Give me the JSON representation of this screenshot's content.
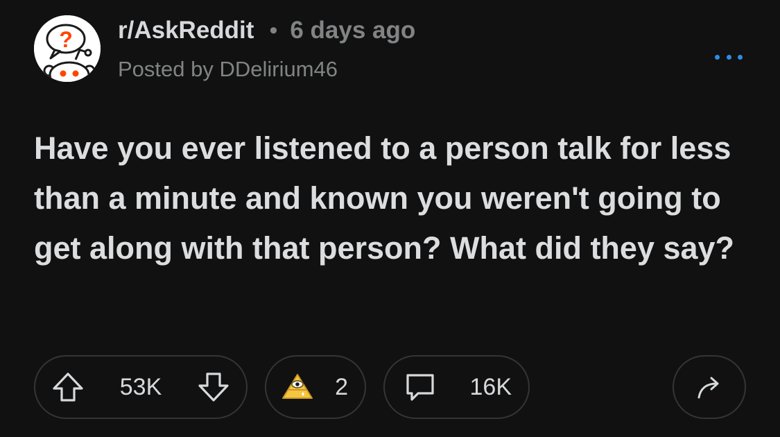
{
  "post": {
    "subreddit": "r/AskReddit",
    "separator": "•",
    "time_ago": "6 days ago",
    "posted_by": "Posted by DDelirium46",
    "title": "Have you ever listened to a person talk for less than a minute and known you weren't going to get along with that person? What did they say?"
  },
  "actions": {
    "score": "53K",
    "awards_count": "2",
    "comments_count": "16K"
  },
  "icons": {
    "avatar": "askreddit-snoo-icon",
    "more": "more-options-icon",
    "upvote": "upvote-arrow-icon",
    "downvote": "downvote-arrow-icon",
    "award": "all-seeing-upvote-award-icon",
    "comment": "comment-bubble-icon",
    "share": "share-arrow-icon"
  },
  "colors": {
    "background": "#111111",
    "text": "#d7dadc",
    "muted": "#818384",
    "accent_blue": "#2b8ee6",
    "snoo_orange": "#ff4500",
    "border": "#343536"
  }
}
